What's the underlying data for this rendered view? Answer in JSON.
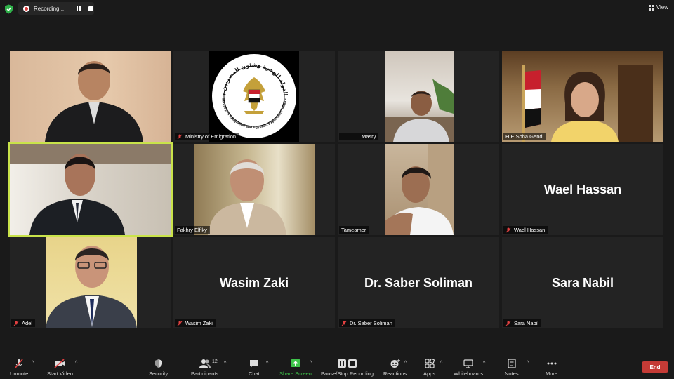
{
  "recording": {
    "label": "Recording...",
    "icon": "record-dot-icon"
  },
  "view": {
    "label": "View",
    "icon": "grid-view-icon"
  },
  "tiles": [
    {
      "name": ""
    },
    {
      "name": "Ministry of Emigration"
    },
    {
      "name": "Masry"
    },
    {
      "name": "H E Soha Gendi"
    },
    {
      "name": ""
    },
    {
      "name": "Fakhry Elfiky"
    },
    {
      "name": "Tameamer"
    },
    {
      "name": "Wael Hassan",
      "display": "Wael Hassan"
    },
    {
      "name": "Adel"
    },
    {
      "name": "Wasim Zaki",
      "display": "Wasim Zaki"
    },
    {
      "name": "Dr. Saber Soliman",
      "display": "Dr. Saber Soliman"
    },
    {
      "name": "Sara Nabil",
      "display": "Sara Nabil"
    }
  ],
  "logo": {
    "arabic": "وزارة الدولة للهجرة وشئون المصريين بالخارج",
    "english": "Ministry of Emigration and Egyptian Expatriates' Affairs"
  },
  "toolbar": {
    "unmute": "Unmute",
    "start_video": "Start Video",
    "security": "Security",
    "participants": "Participants",
    "participants_count": "12",
    "chat": "Chat",
    "share_screen": "Share Screen",
    "recording": "Pause/Stop Recording",
    "reactions": "Reactions",
    "apps": "Apps",
    "whiteboards": "Whiteboards",
    "notes": "Notes",
    "more": "More",
    "end": "End"
  },
  "colors": {
    "active_speaker_border": "#c9e34a",
    "share_green": "#3ec44a",
    "end_red": "#c53b36",
    "record_red": "#d93a3a"
  }
}
